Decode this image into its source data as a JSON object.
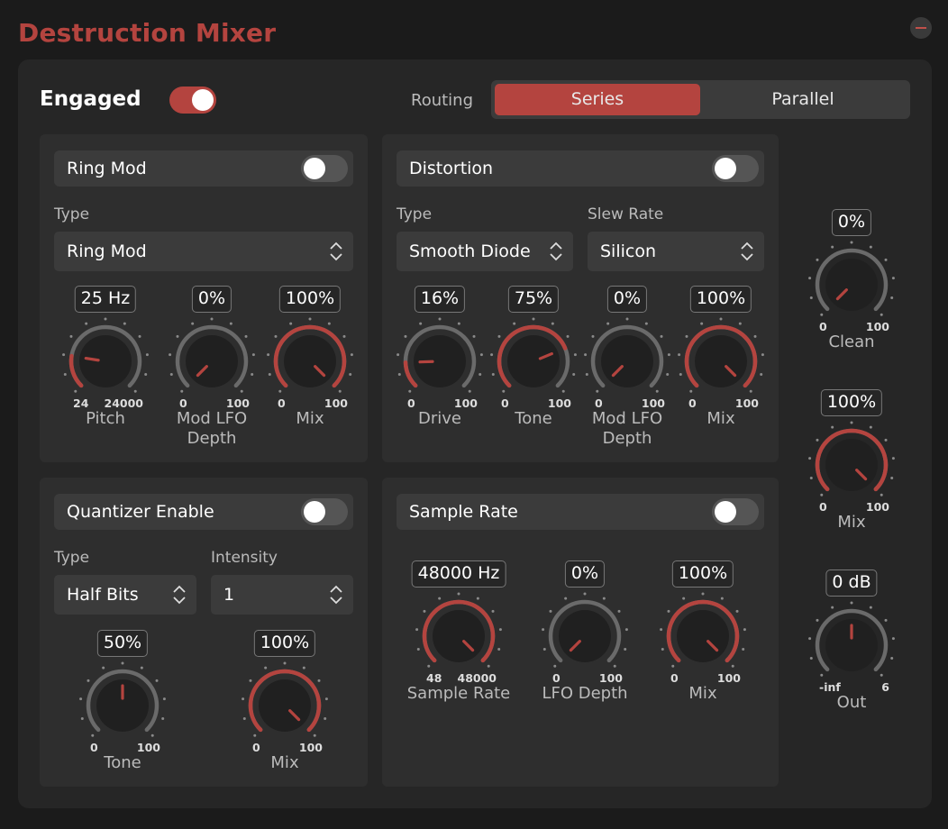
{
  "app": {
    "title": "Destruction Mixer"
  },
  "engaged": {
    "label": "Engaged",
    "on": true
  },
  "routing": {
    "label": "Routing",
    "options": [
      "Series",
      "Parallel"
    ],
    "selected": "Series"
  },
  "ring_mod": {
    "title": "Ring Mod",
    "enabled": false,
    "type_label": "Type",
    "type_value": "Ring Mod",
    "knobs": [
      {
        "value": "25 Hz",
        "fraction": 0.2,
        "min": "24",
        "max": "24000",
        "name": "Pitch"
      },
      {
        "value": "0%",
        "fraction": 0.0,
        "min": "0",
        "max": "100",
        "name": "Mod LFO Depth"
      },
      {
        "value": "100%",
        "fraction": 1.0,
        "min": "0",
        "max": "100",
        "name": "Mix"
      }
    ]
  },
  "distortion": {
    "title": "Distortion",
    "enabled": false,
    "type_label": "Type",
    "type_value": "Smooth Diode",
    "slew_label": "Slew Rate",
    "slew_value": "Silicon",
    "knobs": [
      {
        "value": "16%",
        "fraction": 0.16,
        "min": "0",
        "max": "100",
        "name": "Drive"
      },
      {
        "value": "75%",
        "fraction": 0.75,
        "min": "0",
        "max": "100",
        "name": "Tone"
      },
      {
        "value": "0%",
        "fraction": 0.0,
        "min": "0",
        "max": "100",
        "name": "Mod LFO Depth"
      },
      {
        "value": "100%",
        "fraction": 1.0,
        "min": "0",
        "max": "100",
        "name": "Mix"
      }
    ]
  },
  "quantizer": {
    "title": "Quantizer Enable",
    "enabled": false,
    "type_label": "Type",
    "type_value": "Half Bits",
    "intensity_label": "Intensity",
    "intensity_value": "1",
    "knobs": [
      {
        "value": "50%",
        "fraction": 0.5,
        "min": "0",
        "max": "100",
        "name": "Tone"
      },
      {
        "value": "100%",
        "fraction": 1.0,
        "min": "0",
        "max": "100",
        "name": "Mix"
      }
    ]
  },
  "sample_rate": {
    "title": "Sample Rate",
    "enabled": false,
    "knobs": [
      {
        "value": "48000 Hz",
        "fraction": 1.0,
        "min": "48",
        "max": "48000",
        "name": "Sample Rate"
      },
      {
        "value": "0%",
        "fraction": 0.0,
        "min": "0",
        "max": "100",
        "name": "LFO Depth"
      },
      {
        "value": "100%",
        "fraction": 1.0,
        "min": "0",
        "max": "100",
        "name": "Mix"
      }
    ]
  },
  "output": {
    "knobs": [
      {
        "value": "0%",
        "fraction": 0.0,
        "min": "0",
        "max": "100",
        "name": "Clean"
      },
      {
        "value": "100%",
        "fraction": 1.0,
        "min": "0",
        "max": "100",
        "name": "Mix"
      },
      {
        "value": "0 dB",
        "fraction": 0.5,
        "min": "-inf",
        "max": "6",
        "name": "Out"
      }
    ]
  },
  "colors": {
    "accent": "#b4443f",
    "panel": "#2e2e2e",
    "control": "#3b3b3b",
    "track": "#6a6a6a"
  }
}
